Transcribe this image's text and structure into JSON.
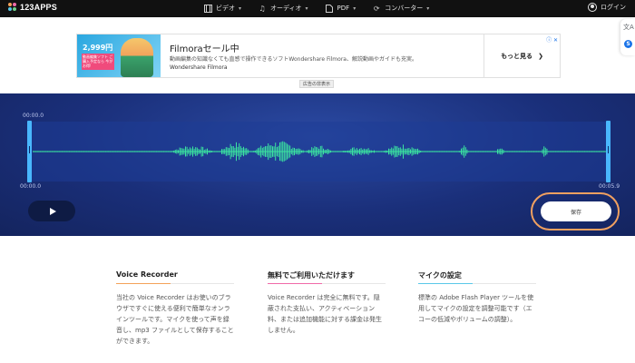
{
  "header": {
    "logo_text": "123APPS",
    "nav": [
      {
        "label": "ビデオ",
        "icon": "film-icon"
      },
      {
        "label": "オーディオ",
        "icon": "music-note-icon"
      },
      {
        "label": "PDF",
        "icon": "document-icon"
      },
      {
        "label": "コンバーター",
        "icon": "convert-icon"
      }
    ],
    "login_label": "ログイン"
  },
  "ad": {
    "thumb_price": "2,999円",
    "thumb_tag": "動画編集ソフト ご購入予定なら 今がお得!",
    "title": "Filmoraセール中",
    "description": "動画編集の知識なくても直感で操作できるソフトWondershare Filmora、解説動画やガイドも充実。",
    "brand": "Wondershare Filmora",
    "more_label": "もっと見る",
    "hide_label": "広告の非表示"
  },
  "editor": {
    "time_top": "00:00.0",
    "time_start": "00:00.0",
    "time_end": "00:05.9",
    "save_label": "保存"
  },
  "info": [
    {
      "title": "Voice Recorder",
      "text": "当社の Voice Recorder はお使いのブラウザですぐに使える便利で簡単なオンラインツールです。マイクを使って声を録音し、mp3 ファイルとして保存することができます。"
    },
    {
      "title": "無料でご利用いただけます",
      "text": "Voice Recorder は完全に無料です。隠蔽された支払い、アクティベーション料、または追加機能に対する課金は発生しません。"
    },
    {
      "title": "マイクの設定",
      "text": "標準の Adobe Flash Player ツールを使用してマイクの設定を調整可能です（エコーの低減やボリュームの調整）。"
    }
  ],
  "colors": {
    "accent_bar_1": "#f4a259",
    "accent_bar_2": "#f06aa8",
    "accent_bar_3": "#5ac8e8",
    "waveform": "#3be3a0",
    "save_highlight": "#f0a060"
  }
}
